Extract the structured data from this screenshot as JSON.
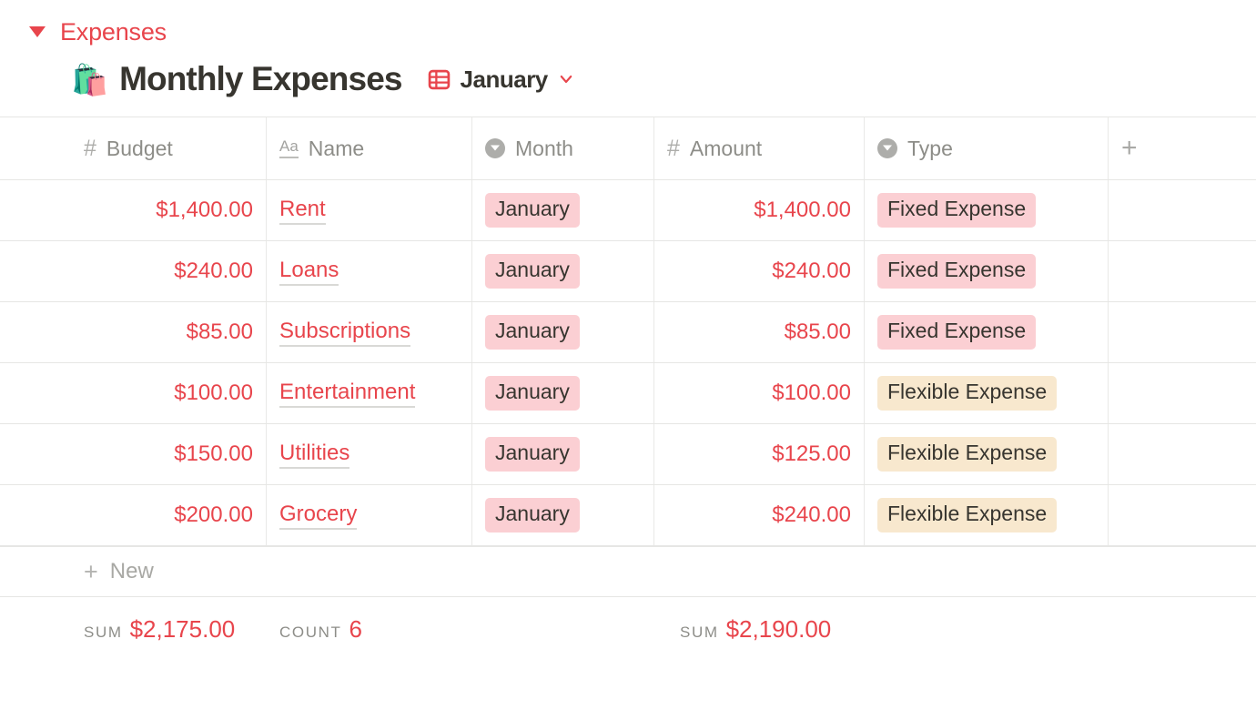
{
  "section": {
    "title": "Expenses",
    "toggle_icon": "triangle-down-icon",
    "accent_color": "#e8454c"
  },
  "database": {
    "emoji": "🛍️",
    "title": "Monthly Expenses",
    "view_icon": "table-grid-icon",
    "view_name": "January",
    "view_chevron_icon": "chevron-down-icon"
  },
  "table": {
    "columns": [
      {
        "label": "Budget",
        "icon": "number-hash-icon",
        "type": "number"
      },
      {
        "label": "Name",
        "icon": "text-aa-icon",
        "type": "title"
      },
      {
        "label": "Month",
        "icon": "select-circle-icon",
        "type": "select"
      },
      {
        "label": "Amount",
        "icon": "number-hash-icon",
        "type": "number"
      },
      {
        "label": "Type",
        "icon": "select-circle-icon",
        "type": "select"
      }
    ],
    "add_column_icon": "plus-icon",
    "rows": [
      {
        "budget": "$1,400.00",
        "name": "Rent",
        "month": "January",
        "amount": "$1,400.00",
        "type": "Fixed Expense",
        "type_color": "pink"
      },
      {
        "budget": "$240.00",
        "name": "Loans",
        "month": "January",
        "amount": "$240.00",
        "type": "Fixed Expense",
        "type_color": "pink"
      },
      {
        "budget": "$85.00",
        "name": "Subscriptions",
        "month": "January",
        "amount": "$85.00",
        "type": "Fixed Expense",
        "type_color": "pink"
      },
      {
        "budget": "$100.00",
        "name": "Entertainment",
        "month": "January",
        "amount": "$100.00",
        "type": "Flexible Expense",
        "type_color": "cream"
      },
      {
        "budget": "$150.00",
        "name": "Utilities",
        "month": "January",
        "amount": "$125.00",
        "type": "Flexible Expense",
        "type_color": "cream"
      },
      {
        "budget": "$200.00",
        "name": "Grocery",
        "month": "January",
        "amount": "$240.00",
        "type": "Flexible Expense",
        "type_color": "cream"
      }
    ],
    "new_row": {
      "label": "New",
      "icon": "plus-icon"
    },
    "footer": {
      "budget": {
        "label": "SUM",
        "value": "$2,175.00"
      },
      "name": {
        "label": "COUNT",
        "value": "6"
      },
      "amount": {
        "label": "SUM",
        "value": "$2,190.00"
      }
    }
  },
  "colors": {
    "accent_red": "#e8454c",
    "pill_pink": "#fbcfd3",
    "pill_cream": "#f8e8ce",
    "border": "#e6e6e4",
    "muted_text": "#8d8d88"
  }
}
